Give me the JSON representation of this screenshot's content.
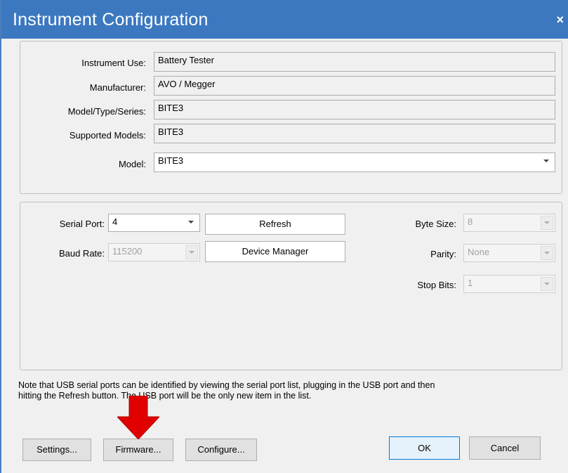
{
  "window": {
    "title": "Instrument Configuration",
    "close_glyph": "×"
  },
  "instrument": {
    "use_label": "Instrument Use:",
    "use_value": "Battery Tester",
    "manufacturer_label": "Manufacturer:",
    "manufacturer_value": "AVO / Megger",
    "model_type_label": "Model/Type/Series:",
    "model_type_value": "BITE3",
    "supported_label": "Supported Models:",
    "supported_value": "BITE3",
    "model_label": "Model:",
    "model_value": "BITE3"
  },
  "serial": {
    "port_label": "Serial Port:",
    "port_value": "4",
    "baud_label": "Baud Rate:",
    "baud_value": "115200",
    "refresh_label": "Refresh",
    "device_manager_label": "Device Manager",
    "byte_size_label": "Byte Size:",
    "byte_size_value": "8",
    "parity_label": "Parity:",
    "parity_value": "None",
    "stop_bits_label": "Stop Bits:",
    "stop_bits_value": "1"
  },
  "note": {
    "line1": "Note that USB serial ports can be identified by viewing the serial port list, plugging in the USB port and then",
    "line2": "hitting the Refresh button. The USB port will be the only new item in the list."
  },
  "footer": {
    "settings_label": "Settings...",
    "firmware_label": "Firmware...",
    "configure_label": "Configure...",
    "ok_label": "OK",
    "cancel_label": "Cancel"
  },
  "colors": {
    "titlebar": "#3c78c0",
    "arrow": "#e00000"
  },
  "icons": {
    "close": "close-icon",
    "annotation": "red-down-arrow-icon"
  }
}
